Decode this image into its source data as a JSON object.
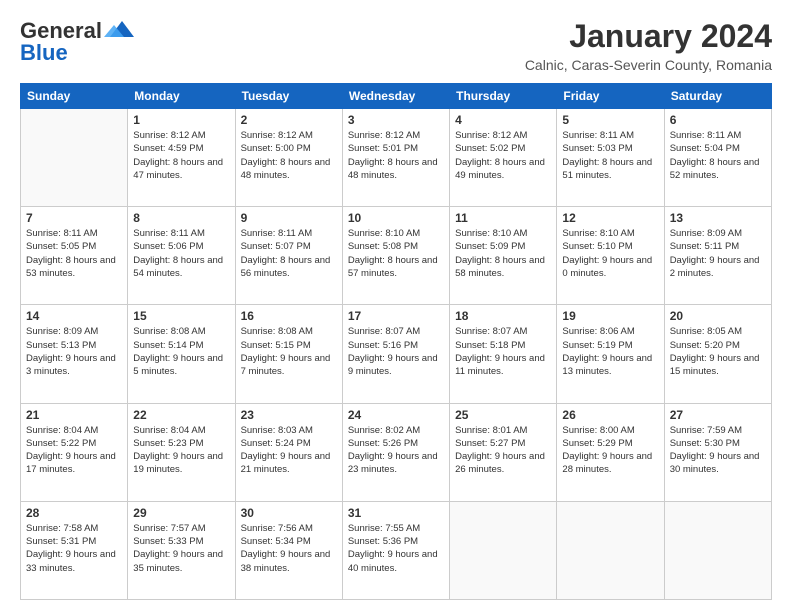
{
  "logo": {
    "general": "General",
    "blue": "Blue",
    "tagline": "Blue"
  },
  "header": {
    "title": "January 2024",
    "subtitle": "Calnic, Caras-Severin County, Romania"
  },
  "weekdays": [
    "Sunday",
    "Monday",
    "Tuesday",
    "Wednesday",
    "Thursday",
    "Friday",
    "Saturday"
  ],
  "weeks": [
    [
      {
        "day": "",
        "sunrise": "",
        "sunset": "",
        "daylight": ""
      },
      {
        "day": "1",
        "sunrise": "Sunrise: 8:12 AM",
        "sunset": "Sunset: 4:59 PM",
        "daylight": "Daylight: 8 hours and 47 minutes."
      },
      {
        "day": "2",
        "sunrise": "Sunrise: 8:12 AM",
        "sunset": "Sunset: 5:00 PM",
        "daylight": "Daylight: 8 hours and 48 minutes."
      },
      {
        "day": "3",
        "sunrise": "Sunrise: 8:12 AM",
        "sunset": "Sunset: 5:01 PM",
        "daylight": "Daylight: 8 hours and 48 minutes."
      },
      {
        "day": "4",
        "sunrise": "Sunrise: 8:12 AM",
        "sunset": "Sunset: 5:02 PM",
        "daylight": "Daylight: 8 hours and 49 minutes."
      },
      {
        "day": "5",
        "sunrise": "Sunrise: 8:11 AM",
        "sunset": "Sunset: 5:03 PM",
        "daylight": "Daylight: 8 hours and 51 minutes."
      },
      {
        "day": "6",
        "sunrise": "Sunrise: 8:11 AM",
        "sunset": "Sunset: 5:04 PM",
        "daylight": "Daylight: 8 hours and 52 minutes."
      }
    ],
    [
      {
        "day": "7",
        "sunrise": "Sunrise: 8:11 AM",
        "sunset": "Sunset: 5:05 PM",
        "daylight": "Daylight: 8 hours and 53 minutes."
      },
      {
        "day": "8",
        "sunrise": "Sunrise: 8:11 AM",
        "sunset": "Sunset: 5:06 PM",
        "daylight": "Daylight: 8 hours and 54 minutes."
      },
      {
        "day": "9",
        "sunrise": "Sunrise: 8:11 AM",
        "sunset": "Sunset: 5:07 PM",
        "daylight": "Daylight: 8 hours and 56 minutes."
      },
      {
        "day": "10",
        "sunrise": "Sunrise: 8:10 AM",
        "sunset": "Sunset: 5:08 PM",
        "daylight": "Daylight: 8 hours and 57 minutes."
      },
      {
        "day": "11",
        "sunrise": "Sunrise: 8:10 AM",
        "sunset": "Sunset: 5:09 PM",
        "daylight": "Daylight: 8 hours and 58 minutes."
      },
      {
        "day": "12",
        "sunrise": "Sunrise: 8:10 AM",
        "sunset": "Sunset: 5:10 PM",
        "daylight": "Daylight: 9 hours and 0 minutes."
      },
      {
        "day": "13",
        "sunrise": "Sunrise: 8:09 AM",
        "sunset": "Sunset: 5:11 PM",
        "daylight": "Daylight: 9 hours and 2 minutes."
      }
    ],
    [
      {
        "day": "14",
        "sunrise": "Sunrise: 8:09 AM",
        "sunset": "Sunset: 5:13 PM",
        "daylight": "Daylight: 9 hours and 3 minutes."
      },
      {
        "day": "15",
        "sunrise": "Sunrise: 8:08 AM",
        "sunset": "Sunset: 5:14 PM",
        "daylight": "Daylight: 9 hours and 5 minutes."
      },
      {
        "day": "16",
        "sunrise": "Sunrise: 8:08 AM",
        "sunset": "Sunset: 5:15 PM",
        "daylight": "Daylight: 9 hours and 7 minutes."
      },
      {
        "day": "17",
        "sunrise": "Sunrise: 8:07 AM",
        "sunset": "Sunset: 5:16 PM",
        "daylight": "Daylight: 9 hours and 9 minutes."
      },
      {
        "day": "18",
        "sunrise": "Sunrise: 8:07 AM",
        "sunset": "Sunset: 5:18 PM",
        "daylight": "Daylight: 9 hours and 11 minutes."
      },
      {
        "day": "19",
        "sunrise": "Sunrise: 8:06 AM",
        "sunset": "Sunset: 5:19 PM",
        "daylight": "Daylight: 9 hours and 13 minutes."
      },
      {
        "day": "20",
        "sunrise": "Sunrise: 8:05 AM",
        "sunset": "Sunset: 5:20 PM",
        "daylight": "Daylight: 9 hours and 15 minutes."
      }
    ],
    [
      {
        "day": "21",
        "sunrise": "Sunrise: 8:04 AM",
        "sunset": "Sunset: 5:22 PM",
        "daylight": "Daylight: 9 hours and 17 minutes."
      },
      {
        "day": "22",
        "sunrise": "Sunrise: 8:04 AM",
        "sunset": "Sunset: 5:23 PM",
        "daylight": "Daylight: 9 hours and 19 minutes."
      },
      {
        "day": "23",
        "sunrise": "Sunrise: 8:03 AM",
        "sunset": "Sunset: 5:24 PM",
        "daylight": "Daylight: 9 hours and 21 minutes."
      },
      {
        "day": "24",
        "sunrise": "Sunrise: 8:02 AM",
        "sunset": "Sunset: 5:26 PM",
        "daylight": "Daylight: 9 hours and 23 minutes."
      },
      {
        "day": "25",
        "sunrise": "Sunrise: 8:01 AM",
        "sunset": "Sunset: 5:27 PM",
        "daylight": "Daylight: 9 hours and 26 minutes."
      },
      {
        "day": "26",
        "sunrise": "Sunrise: 8:00 AM",
        "sunset": "Sunset: 5:29 PM",
        "daylight": "Daylight: 9 hours and 28 minutes."
      },
      {
        "day": "27",
        "sunrise": "Sunrise: 7:59 AM",
        "sunset": "Sunset: 5:30 PM",
        "daylight": "Daylight: 9 hours and 30 minutes."
      }
    ],
    [
      {
        "day": "28",
        "sunrise": "Sunrise: 7:58 AM",
        "sunset": "Sunset: 5:31 PM",
        "daylight": "Daylight: 9 hours and 33 minutes."
      },
      {
        "day": "29",
        "sunrise": "Sunrise: 7:57 AM",
        "sunset": "Sunset: 5:33 PM",
        "daylight": "Daylight: 9 hours and 35 minutes."
      },
      {
        "day": "30",
        "sunrise": "Sunrise: 7:56 AM",
        "sunset": "Sunset: 5:34 PM",
        "daylight": "Daylight: 9 hours and 38 minutes."
      },
      {
        "day": "31",
        "sunrise": "Sunrise: 7:55 AM",
        "sunset": "Sunset: 5:36 PM",
        "daylight": "Daylight: 9 hours and 40 minutes."
      },
      {
        "day": "",
        "sunrise": "",
        "sunset": "",
        "daylight": ""
      },
      {
        "day": "",
        "sunrise": "",
        "sunset": "",
        "daylight": ""
      },
      {
        "day": "",
        "sunrise": "",
        "sunset": "",
        "daylight": ""
      }
    ]
  ]
}
